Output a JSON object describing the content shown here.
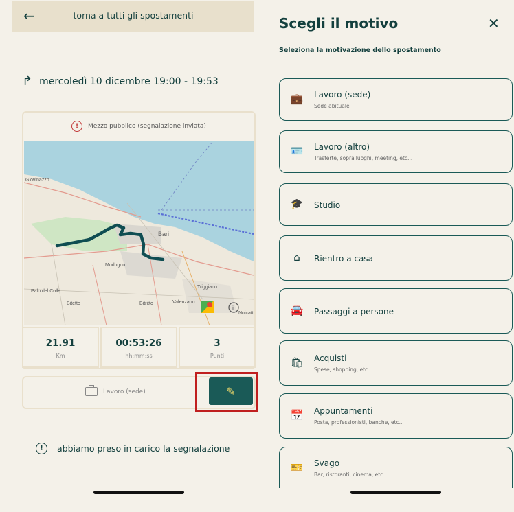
{
  "left": {
    "topbar": {
      "back_icon": "arrow-left-icon",
      "title": "torna a tutti gli spostamenti"
    },
    "date_line": "mercoledì 10 dicembre 19:00 - 19:53",
    "warning": "Mezzo pubblico (segnalazione inviata)",
    "map": {
      "labels": [
        "Giovinazzo",
        "Bari",
        "Modugno",
        "Palo del Colle",
        "Bitetto",
        "Bitritto",
        "Valenzano",
        "Triggiano",
        "Noicatt"
      ],
      "route_color": "#0f4d52"
    },
    "stats": [
      {
        "value": "21.91",
        "unit": "Km"
      },
      {
        "value": "00:53:26",
        "unit": "hh:mm:ss"
      },
      {
        "value": "3",
        "unit": "Punti"
      }
    ],
    "reason_label": "Lavoro (sede)",
    "notice": "abbiamo preso in carico la segnalazione"
  },
  "right": {
    "title": "Scegli il motivo",
    "subtitle": "Seleziona la motivazione dello spostamento",
    "options": [
      {
        "icon": "briefcase-icon",
        "label": "Lavoro (sede)",
        "sub": "Sede abituale"
      },
      {
        "icon": "badge-icon",
        "label": "Lavoro (altro)",
        "sub": "Trasferte, sopralluoghi, meeting, etc..."
      },
      {
        "icon": "graduation-cap-icon",
        "label": "Studio",
        "sub": ""
      },
      {
        "icon": "home-icon",
        "label": "Rientro a casa",
        "sub": ""
      },
      {
        "icon": "car-icon",
        "label": "Passaggi a persone",
        "sub": ""
      },
      {
        "icon": "shopping-bag-icon",
        "label": "Acquisti",
        "sub": "Spese, shopping, etc..."
      },
      {
        "icon": "calendar-icon",
        "label": "Appuntamenti",
        "sub": "Posta, professionisti, banche, etc..."
      },
      {
        "icon": "ticket-icon",
        "label": "Svago",
        "sub": "Bar, ristoranti, cinema, etc..."
      }
    ]
  },
  "colors": {
    "accent": "#1a5a57",
    "background": "#f4f1e9",
    "highlight": "#c01f1f",
    "topbar": "#e8e0cc"
  }
}
